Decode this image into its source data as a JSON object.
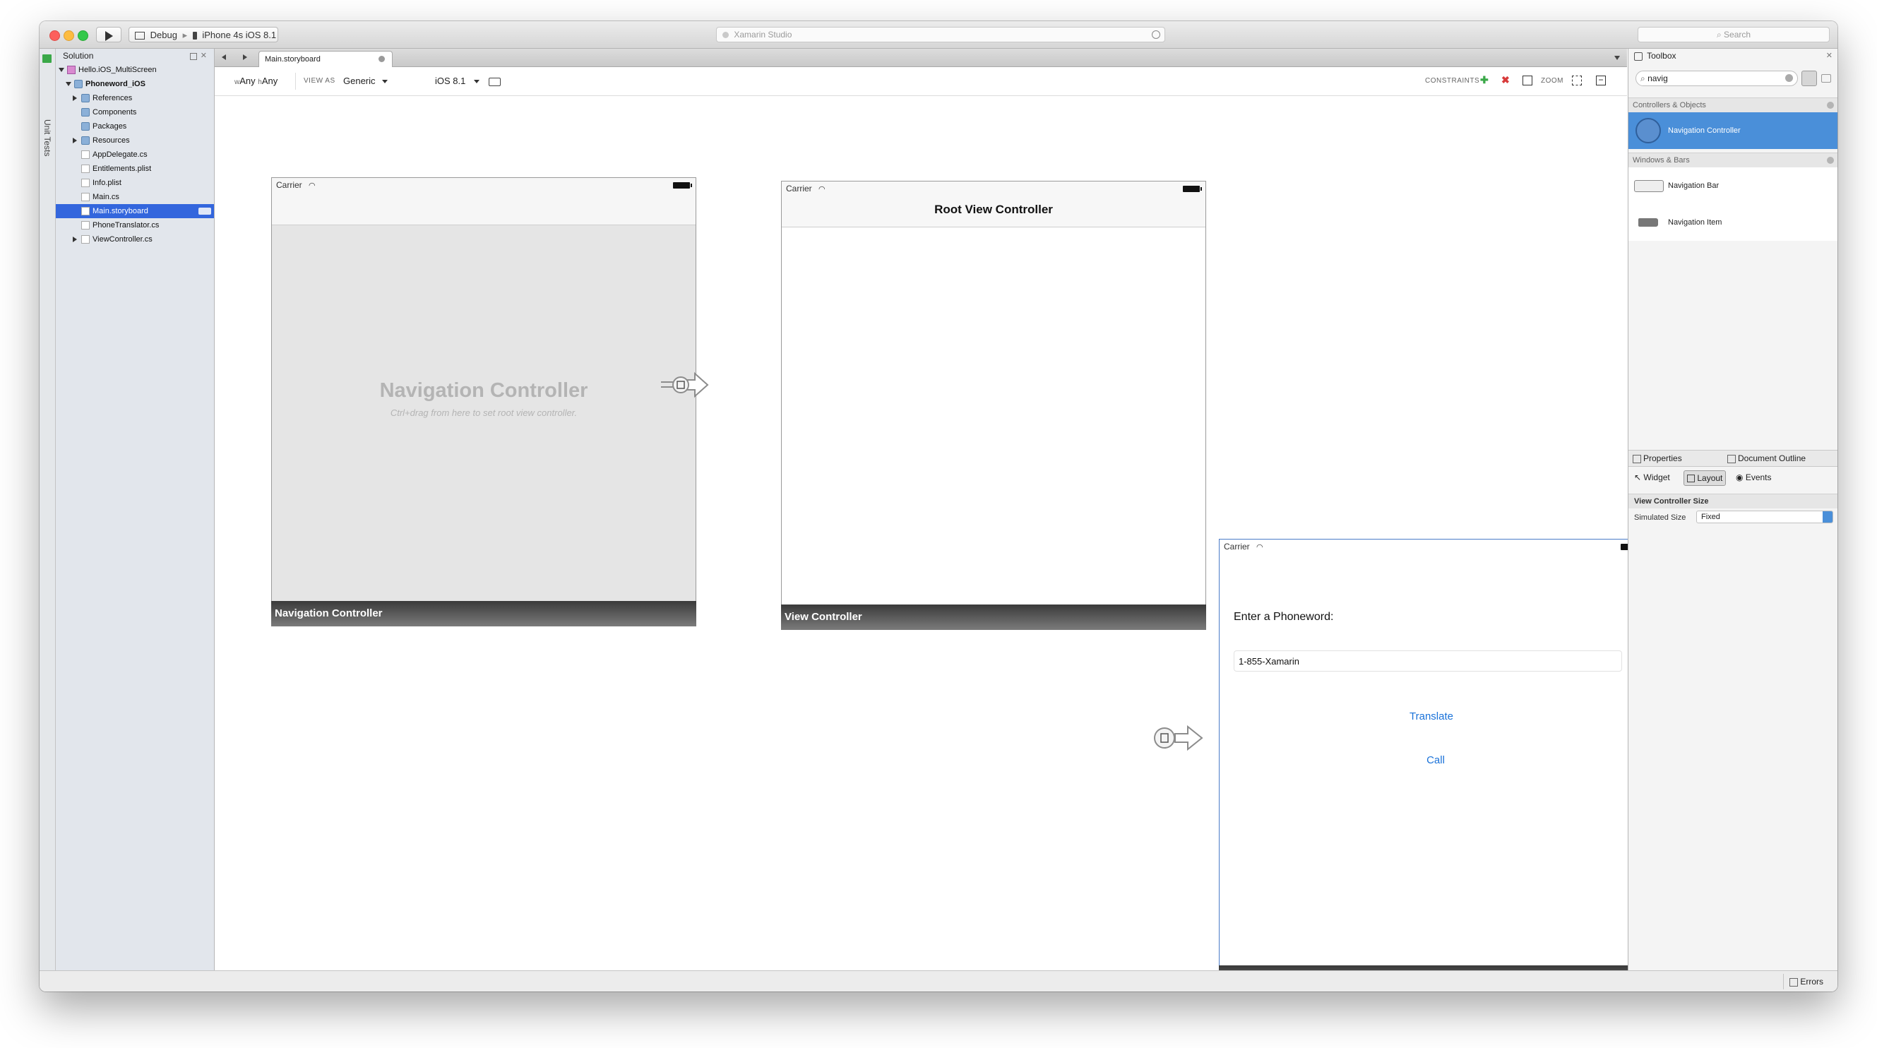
{
  "titlebar": {
    "config": "Debug",
    "separator": "▸",
    "device": "iPhone 4s iOS 8.1",
    "status": "Xamarin Studio",
    "search_placeholder": "Search"
  },
  "left_strip": {
    "label": "Unit Tests"
  },
  "solution": {
    "title": "Solution",
    "items": [
      {
        "label": "Hello.iOS_MultiScreen",
        "depth": 0,
        "type": "solution",
        "expand": "down"
      },
      {
        "label": "Phoneword_iOS",
        "depth": 1,
        "type": "project",
        "expand": "down"
      },
      {
        "label": "References",
        "depth": 2,
        "type": "folder",
        "expand": "right"
      },
      {
        "label": "Components",
        "depth": 2,
        "type": "folder",
        "expand": ""
      },
      {
        "label": "Packages",
        "depth": 2,
        "type": "folder",
        "expand": ""
      },
      {
        "label": "Resources",
        "depth": 2,
        "type": "folder",
        "expand": "right"
      },
      {
        "label": "AppDelegate.cs",
        "depth": 2,
        "type": "file",
        "expand": ""
      },
      {
        "label": "Entitlements.plist",
        "depth": 2,
        "type": "file",
        "expand": ""
      },
      {
        "label": "Info.plist",
        "depth": 2,
        "type": "file",
        "expand": ""
      },
      {
        "label": "Main.cs",
        "depth": 2,
        "type": "file",
        "expand": ""
      },
      {
        "label": "Main.storyboard",
        "depth": 2,
        "type": "file",
        "expand": "",
        "selected": true
      },
      {
        "label": "PhoneTranslator.cs",
        "depth": 2,
        "type": "file",
        "expand": ""
      },
      {
        "label": "ViewController.cs",
        "depth": 2,
        "type": "file",
        "expand": "right"
      }
    ]
  },
  "editor": {
    "tab": "Main.storyboard",
    "size_class": {
      "w_prefix": "w",
      "w": "Any",
      "h_prefix": "h",
      "h": "Any"
    },
    "view_as_label": "VIEW AS",
    "view_as": "Generic",
    "ios_version": "iOS 8.1",
    "constraints_label": "CONSTRAINTS",
    "zoom_label": "ZOOM"
  },
  "scenes": {
    "nav": {
      "carrier": "Carrier",
      "title": "Navigation Controller",
      "hint": "Ctrl+drag from here to set root view controller.",
      "footer": "Navigation Controller"
    },
    "root": {
      "carrier": "Carrier",
      "nav_title": "Root View Controller",
      "footer": "View Controller"
    },
    "phoneword": {
      "carrier": "Carrier",
      "label": "Enter a Phoneword:",
      "text_value": "1-855-Xamarin",
      "translate": "Translate",
      "call": "Call"
    }
  },
  "toolbox": {
    "title": "Toolbox",
    "search_value": "navig",
    "sections": [
      {
        "title": "Controllers & Objects",
        "items": [
          "Navigation Controller"
        ]
      },
      {
        "title": "Windows & Bars",
        "items": [
          "Navigation Bar",
          "Navigation Item"
        ]
      }
    ]
  },
  "properties": {
    "tab_properties": "Properties",
    "tab_outline": "Document Outline",
    "subtabs": [
      "Widget",
      "Layout",
      "Events"
    ],
    "section": "View Controller Size",
    "simulated_size_label": "Simulated Size",
    "simulated_size_value": "Fixed"
  },
  "statusbar": {
    "errors": "Errors"
  },
  "colors": {
    "accent": "#3366dd",
    "toolbox_selected": "#4a8fd9",
    "link": "#1a72d9"
  }
}
